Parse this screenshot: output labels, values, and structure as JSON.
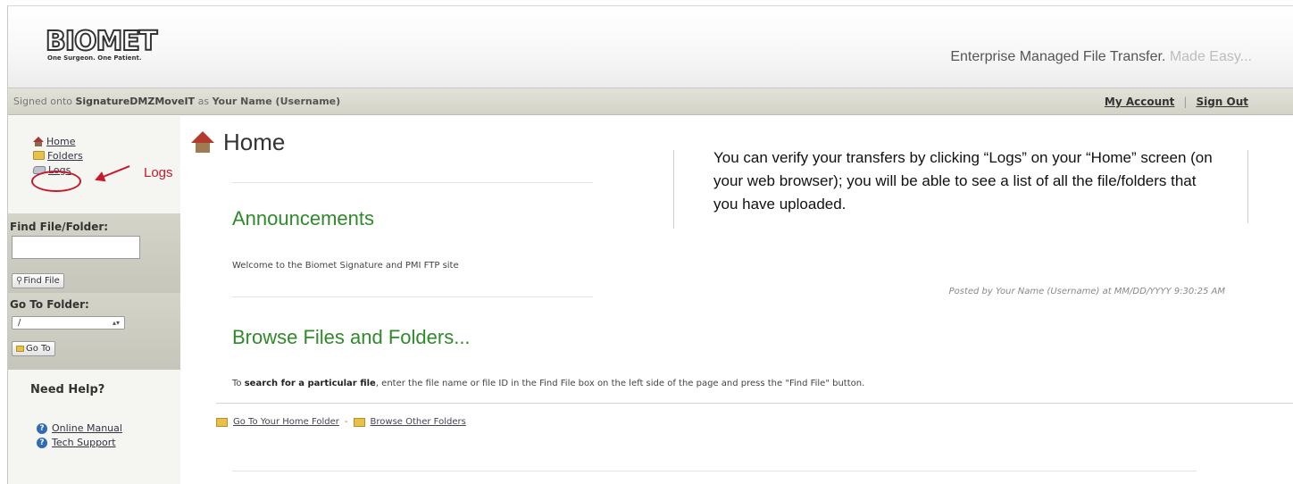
{
  "header": {
    "logo_text": "BIOMET",
    "logo_tagline": "One Surgeon. One Patient.",
    "tagline_main": "Enterprise Managed File Transfer.",
    "tagline_faded": "Made Easy..."
  },
  "statusbar": {
    "signed_prefix": "Signed onto",
    "server": "SignatureDMZMoveIT",
    "as_word": "as",
    "user": "Your Name (Username)",
    "my_account": "My Account",
    "separator": "|",
    "sign_out": "Sign Out"
  },
  "sidebar": {
    "nav": {
      "home": "Home",
      "folders": "Folders",
      "logs": "Logs"
    },
    "logs_callout": "Logs",
    "find": {
      "label": "Find File/Folder:",
      "input_value": "",
      "button": "Find File"
    },
    "goto": {
      "label": "Go To Folder:",
      "selected": "/",
      "button": "Go To"
    },
    "help": {
      "title": "Need Help?",
      "manual": "Online Manual",
      "support": "Tech Support"
    }
  },
  "main": {
    "title": "Home",
    "announcements": {
      "heading": "Announcements",
      "text": "Welcome to the Biomet Signature and PMI FTP site",
      "posted": "Posted by Your Name (Username) at MM/DD/YYYY 9:30:25 AM"
    },
    "browse": {
      "heading": "Browse Files and Folders...",
      "text_prefix": "To",
      "text_bold": "search for a particular file",
      "text_suffix": ", enter the file name or file ID in the Find File box on the left side of the page and press the \"Find File\" button.",
      "home_folder_link": "Go To Your Home Folder",
      "dash": "-",
      "other_folders_link": "Browse Other Folders"
    }
  },
  "note": "You can verify your transfers by clicking “Logs” on your “Home” screen (on your web browser); you will be able to see a list of all the file/folders that you have uploaded.",
  "colors": {
    "accent_green": "#2f8a2a",
    "annotation_red": "#c8192a"
  }
}
